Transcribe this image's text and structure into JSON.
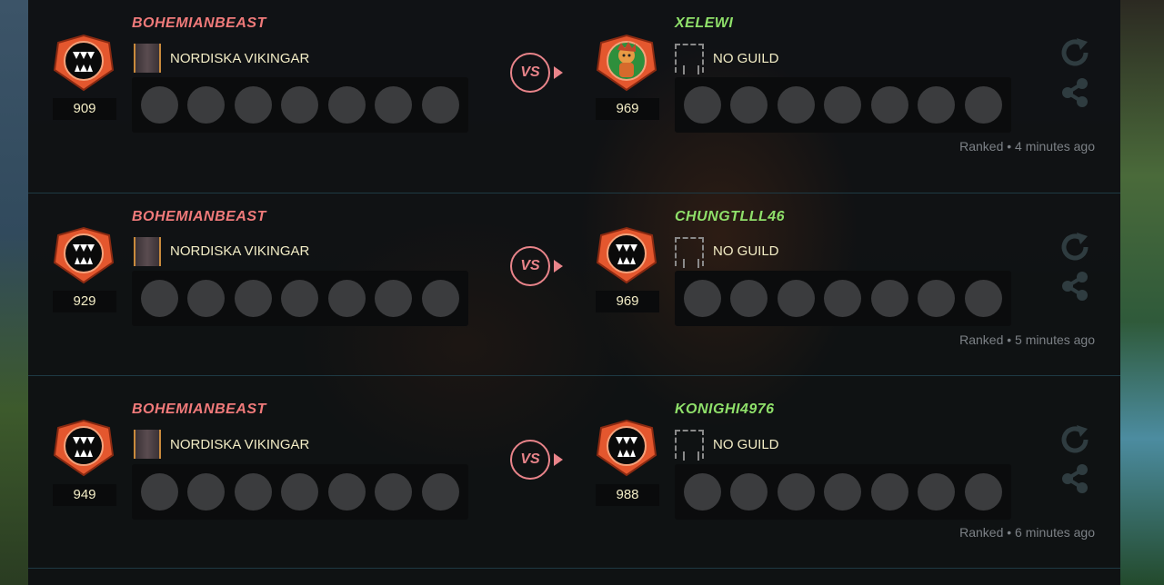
{
  "battles": [
    {
      "left": {
        "name": "BOHEMIANBEAST",
        "guild": "NORDISKA VIKINGAR",
        "rating": "909"
      },
      "vs_label": "VS",
      "right": {
        "name": "XELEWI",
        "guild": "NO GUILD",
        "rating": "969",
        "avatar": "character-avatar"
      },
      "meta": "Ranked • 4 minutes ago"
    },
    {
      "left": {
        "name": "BOHEMIANBEAST",
        "guild": "NORDISKA VIKINGAR",
        "rating": "929"
      },
      "vs_label": "VS",
      "right": {
        "name": "CHUNGTLLL46",
        "guild": "NO GUILD",
        "rating": "969",
        "avatar": "fang-badge"
      },
      "meta": "Ranked • 5 minutes ago"
    },
    {
      "left": {
        "name": "BOHEMIANBEAST",
        "guild": "NORDISKA VIKINGAR",
        "rating": "949"
      },
      "vs_label": "VS",
      "right": {
        "name": "KONIGHI4976",
        "guild": "NO GUILD",
        "rating": "988",
        "avatar": "fang-badge"
      },
      "meta": "Ranked • 6 minutes ago"
    }
  ],
  "icons": {
    "replay": "replay-icon",
    "share": "share-icon"
  },
  "colors": {
    "left_name": "#f07a7a",
    "right_name": "#8fe06a",
    "badge_orange": "#e4572e",
    "vs": "#e9848a"
  }
}
